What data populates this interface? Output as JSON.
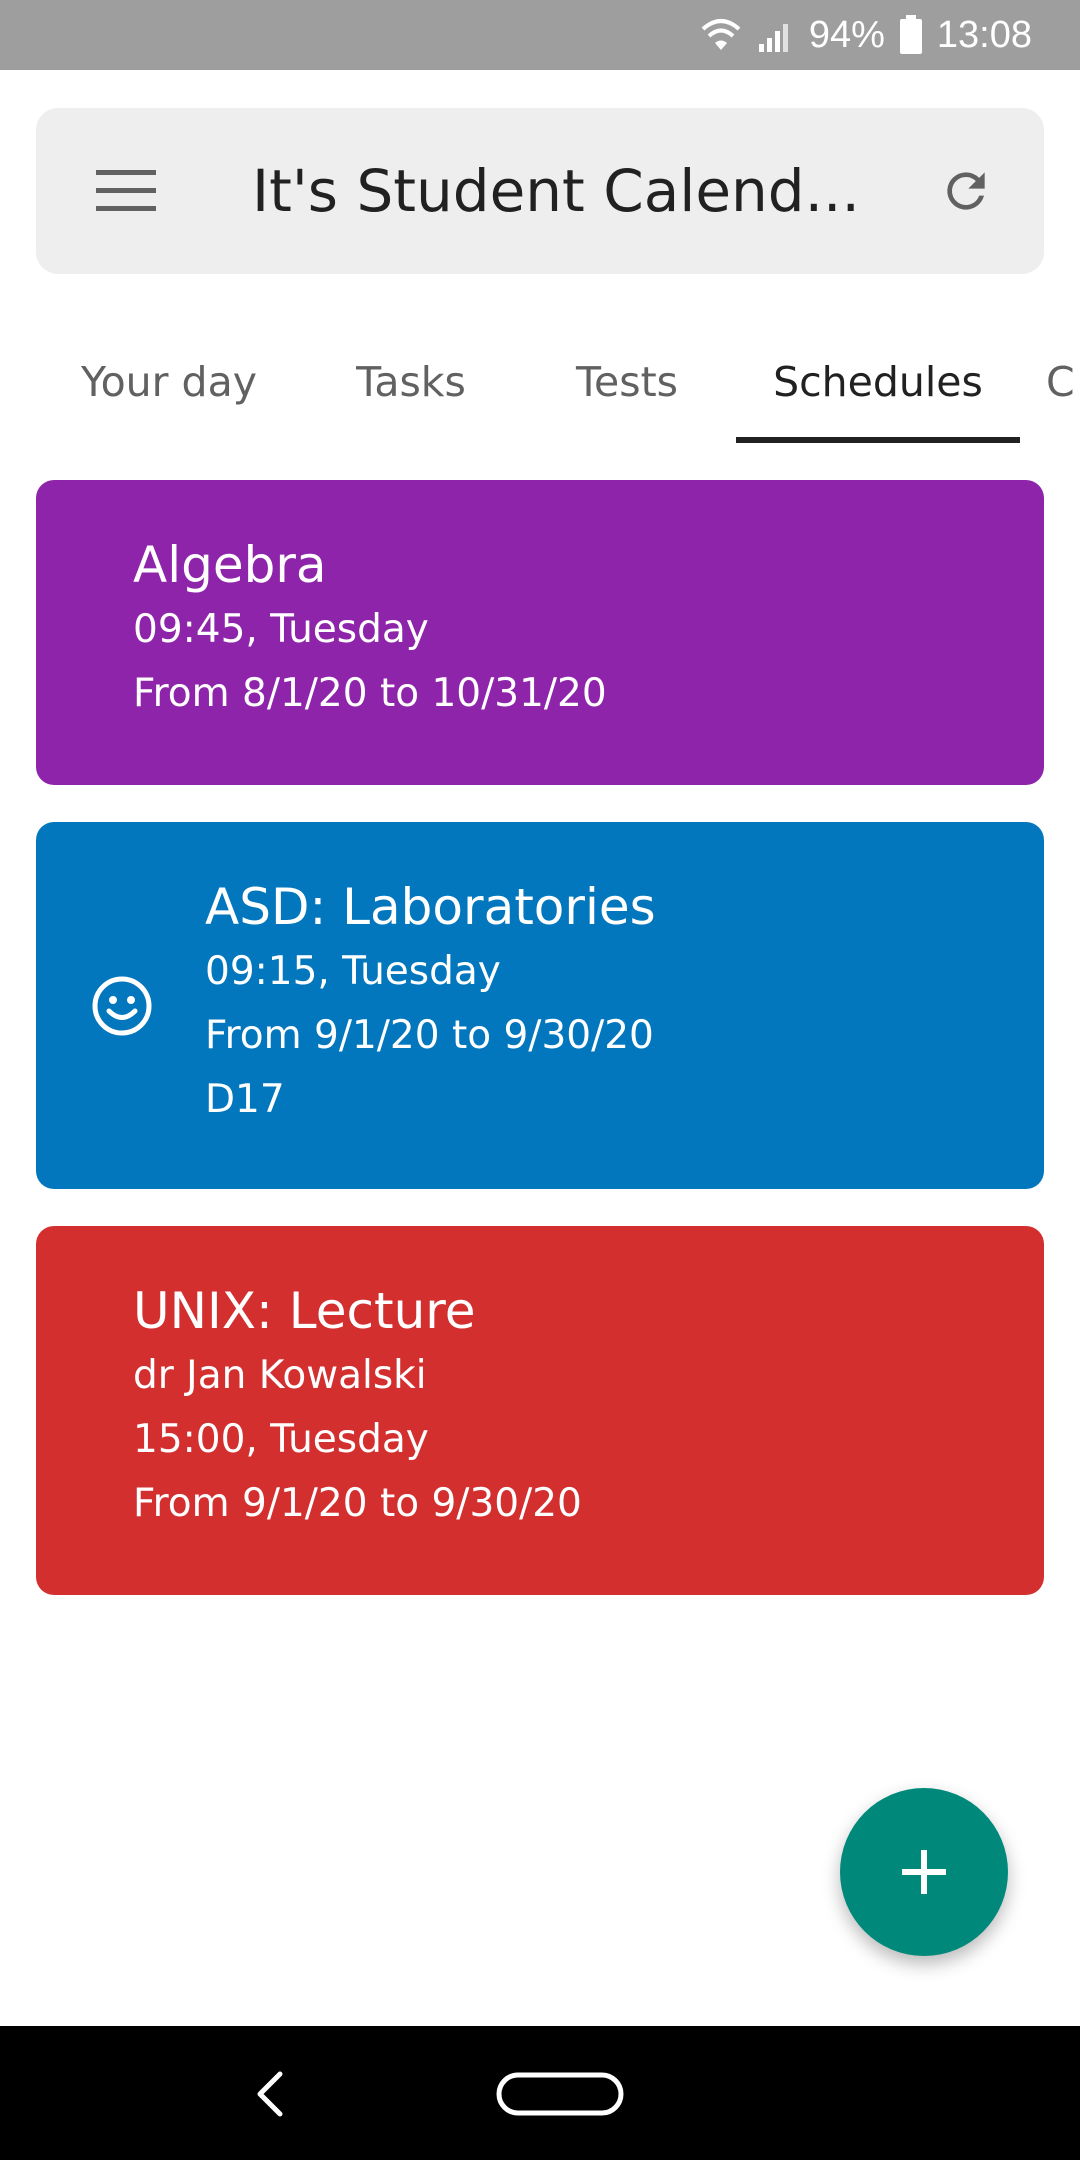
{
  "status_bar": {
    "battery_percent": "94%",
    "time": "13:08",
    "icons": [
      "wifi-icon",
      "signal-icon",
      "battery-icon"
    ]
  },
  "app_bar": {
    "title": "It's Student Calend...",
    "menu_icon": "menu-icon",
    "refresh_icon": "refresh-icon"
  },
  "tabs": [
    {
      "label": "Your day",
      "active": false
    },
    {
      "label": "Tasks",
      "active": false
    },
    {
      "label": "Tests",
      "active": false
    },
    {
      "label": "Schedules",
      "active": true
    },
    {
      "label": "C",
      "active": false
    }
  ],
  "schedules": [
    {
      "color": "#8e24aa",
      "title": "Algebra",
      "time": "09:45, Tuesday",
      "range": "From 8/1/20 to 10/31/20"
    },
    {
      "color": "#0277bd",
      "icon": "smiley-icon",
      "title": "ASD: Laboratories",
      "time": "09:15, Tuesday",
      "range": "From 9/1/20 to 9/30/20",
      "room": "D17"
    },
    {
      "color": "#d32f2f",
      "title": "UNIX: Lecture",
      "teacher": "dr Jan Kowalski",
      "time": "15:00, Tuesday",
      "range": "From 9/1/20 to 9/30/20"
    }
  ],
  "fab": {
    "icon": "plus-icon",
    "color": "#00897b"
  },
  "nav_bar": {
    "icons": [
      "back-icon",
      "home-icon"
    ]
  }
}
